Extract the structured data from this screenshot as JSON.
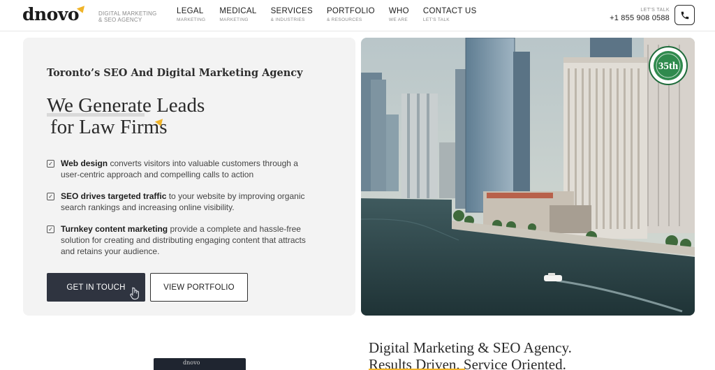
{
  "header": {
    "logo": "dnovo",
    "tagline_line1": "DIGITAL MARKETING",
    "tagline_line2": "& SEO AGENCY",
    "nav": [
      {
        "label": "LEGAL",
        "sub": "MARKETING"
      },
      {
        "label": "MEDICAL",
        "sub": "MARKETING"
      },
      {
        "label": "SERVICES",
        "sub": "& INDUSTRIES"
      },
      {
        "label": "PORTFOLIO",
        "sub": "& RESOURCES"
      },
      {
        "label": "WHO",
        "sub": "WE ARE"
      },
      {
        "label": "CONTACT US",
        "sub": "LET'S TALK"
      }
    ],
    "talk_label": "LET'S TALK",
    "phone": "+1 855 908 0588",
    "phone_icon": "phone-icon"
  },
  "hero": {
    "kicker": "Toronto’s SEO And Digital Marketing Agency",
    "headline_line1": "We Generate Leads",
    "headline_line2": "for Law Firms",
    "bullets": [
      {
        "bold": "Web design",
        "text": " converts visitors into valuable customers through a user-centric approach and compelling calls to action"
      },
      {
        "bold": "SEO drives targeted traffic",
        "text": " to your website by improving organic search rankings and increasing online visibility."
      },
      {
        "bold": "Turnkey content marketing",
        "text": " provide a complete and hassle-free solution for creating and distributing engaging content that attracts and retains your audience."
      }
    ],
    "cta_primary": "GET IN TOUCH",
    "cta_secondary": "VIEW PORTFOLIO",
    "badge_text": "35th",
    "colors": {
      "accent": "#f0b429",
      "button_dark": "#2f3440",
      "badge_green": "#1d6b3a"
    }
  },
  "section2": {
    "title": "Digital Marketing & SEO Agency.",
    "subtitle_part1": "Results Driven.",
    "subtitle_part2": " Service Oriented.",
    "image_label": "dnovo"
  }
}
